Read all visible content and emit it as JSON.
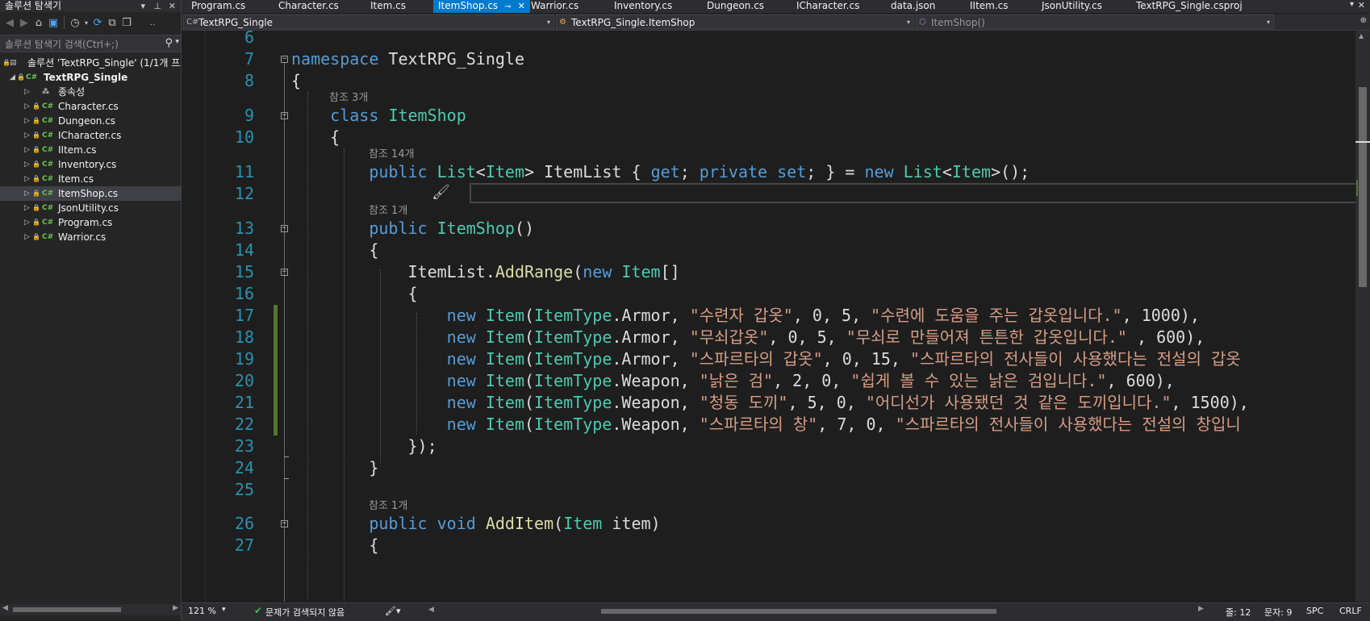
{
  "solution_explorer": {
    "title": "솔루션 탐색기",
    "search_placeholder": "솔루션 탐색기 검색(Ctrl+;)",
    "solution_label": "솔루션 'TextRPG_Single' (1/1개 프로",
    "project_label": "TextRPG_Single",
    "items": [
      {
        "label": "종속성"
      },
      {
        "label": "Character.cs"
      },
      {
        "label": "Dungeon.cs"
      },
      {
        "label": "ICharacter.cs"
      },
      {
        "label": "IItem.cs"
      },
      {
        "label": "Inventory.cs"
      },
      {
        "label": "Item.cs"
      },
      {
        "label": "ItemShop.cs"
      },
      {
        "label": "JsonUtility.cs"
      },
      {
        "label": "Program.cs"
      },
      {
        "label": "Warrior.cs"
      }
    ],
    "selected_item": "ItemShop.cs"
  },
  "tabs": [
    {
      "label": "Program.cs"
    },
    {
      "label": "Character.cs"
    },
    {
      "label": "Item.cs"
    },
    {
      "label": "ItemShop.cs",
      "active": true
    },
    {
      "label": "Warrior.cs"
    },
    {
      "label": "Inventory.cs"
    },
    {
      "label": "Dungeon.cs"
    },
    {
      "label": "ICharacter.cs"
    },
    {
      "label": "data.json"
    },
    {
      "label": "IItem.cs"
    },
    {
      "label": "JsonUtility.cs"
    },
    {
      "label": "TextRPG_Single.csproj"
    }
  ],
  "navbar": {
    "project": "TextRPG_Single",
    "type": "TextRPG_Single.ItemShop",
    "member": "ItemShop()"
  },
  "editor": {
    "lines": [
      {
        "n": "6",
        "tokens": []
      },
      {
        "n": "7",
        "tokens": [
          [
            "kw",
            "namespace"
          ],
          [
            "pl",
            " TextRPG_Single"
          ]
        ]
      },
      {
        "n": "8",
        "tokens": [
          [
            "pl",
            "{"
          ]
        ]
      },
      {
        "n": "9",
        "ref": "참조 3개",
        "tokens": [
          [
            "pl",
            "    "
          ],
          [
            "kw",
            "class"
          ],
          [
            "pl",
            " "
          ],
          [
            "ty",
            "ItemShop"
          ]
        ]
      },
      {
        "n": "10",
        "tokens": [
          [
            "pl",
            "    {"
          ]
        ]
      },
      {
        "n": "11",
        "ref": "참조 14개",
        "tokens": [
          [
            "pl",
            "        "
          ],
          [
            "kw",
            "public"
          ],
          [
            "pl",
            " "
          ],
          [
            "ty",
            "List"
          ],
          [
            "pl",
            "<"
          ],
          [
            "ty",
            "Item"
          ],
          [
            "pl",
            "> ItemList { "
          ],
          [
            "kw",
            "get"
          ],
          [
            "pl",
            "; "
          ],
          [
            "kw",
            "private"
          ],
          [
            "pl",
            " "
          ],
          [
            "kw",
            "set"
          ],
          [
            "pl",
            "; } = "
          ],
          [
            "kw",
            "new"
          ],
          [
            "pl",
            " "
          ],
          [
            "ty",
            "List"
          ],
          [
            "pl",
            "<"
          ],
          [
            "ty",
            "Item"
          ],
          [
            "pl",
            ">();"
          ]
        ]
      },
      {
        "n": "12",
        "tokens": []
      },
      {
        "n": "13",
        "ref": "참조 1개",
        "tokens": [
          [
            "pl",
            "        "
          ],
          [
            "kw",
            "public"
          ],
          [
            "pl",
            " "
          ],
          [
            "ty",
            "ItemShop"
          ],
          [
            "pl",
            "()"
          ]
        ]
      },
      {
        "n": "14",
        "tokens": [
          [
            "pl",
            "        {"
          ]
        ]
      },
      {
        "n": "15",
        "tokens": [
          [
            "pl",
            "            ItemList."
          ],
          [
            "fn",
            "AddRange"
          ],
          [
            "pl",
            "("
          ],
          [
            "kw",
            "new"
          ],
          [
            "pl",
            " "
          ],
          [
            "ty",
            "Item"
          ],
          [
            "pl",
            "[]"
          ]
        ]
      },
      {
        "n": "16",
        "tokens": [
          [
            "pl",
            "            {"
          ]
        ]
      },
      {
        "n": "17",
        "tokens": [
          [
            "pl",
            "                "
          ],
          [
            "kw",
            "new"
          ],
          [
            "pl",
            " "
          ],
          [
            "ty",
            "Item"
          ],
          [
            "pl",
            "("
          ],
          [
            "ty",
            "ItemType"
          ],
          [
            "pl",
            ".Armor, "
          ],
          [
            "st",
            "\"수련자 갑옷\""
          ],
          [
            "pl",
            ", 0, 5, "
          ],
          [
            "st",
            "\"수련에 도움을 주는 갑옷입니다.\""
          ],
          [
            "pl",
            ", 1000),"
          ]
        ]
      },
      {
        "n": "18",
        "tokens": [
          [
            "pl",
            "                "
          ],
          [
            "kw",
            "new"
          ],
          [
            "pl",
            " "
          ],
          [
            "ty",
            "Item"
          ],
          [
            "pl",
            "("
          ],
          [
            "ty",
            "ItemType"
          ],
          [
            "pl",
            ".Armor, "
          ],
          [
            "st",
            "\"무쇠갑옷\""
          ],
          [
            "pl",
            ", 0, 5, "
          ],
          [
            "st",
            "\"무쇠로 만들어져 튼튼한 갑옷입니다.\""
          ],
          [
            "pl",
            " , 600),"
          ]
        ]
      },
      {
        "n": "19",
        "tokens": [
          [
            "pl",
            "                "
          ],
          [
            "kw",
            "new"
          ],
          [
            "pl",
            " "
          ],
          [
            "ty",
            "Item"
          ],
          [
            "pl",
            "("
          ],
          [
            "ty",
            "ItemType"
          ],
          [
            "pl",
            ".Armor, "
          ],
          [
            "st",
            "\"스파르타의 갑옷\""
          ],
          [
            "pl",
            ", 0, 15, "
          ],
          [
            "st",
            "\"스파르타의 전사들이 사용했다는 전설의 갑옷"
          ]
        ]
      },
      {
        "n": "20",
        "tokens": [
          [
            "pl",
            "                "
          ],
          [
            "kw",
            "new"
          ],
          [
            "pl",
            " "
          ],
          [
            "ty",
            "Item"
          ],
          [
            "pl",
            "("
          ],
          [
            "ty",
            "ItemType"
          ],
          [
            "pl",
            ".Weapon, "
          ],
          [
            "st",
            "\"낡은 검\""
          ],
          [
            "pl",
            ", 2, 0, "
          ],
          [
            "st",
            "\"쉽게 볼 수 있는 낡은 검입니다.\""
          ],
          [
            "pl",
            ", 600),"
          ]
        ]
      },
      {
        "n": "21",
        "tokens": [
          [
            "pl",
            "                "
          ],
          [
            "kw",
            "new"
          ],
          [
            "pl",
            " "
          ],
          [
            "ty",
            "Item"
          ],
          [
            "pl",
            "("
          ],
          [
            "ty",
            "ItemType"
          ],
          [
            "pl",
            ".Weapon, "
          ],
          [
            "st",
            "\"청동 도끼\""
          ],
          [
            "pl",
            ", 5, 0, "
          ],
          [
            "st",
            "\"어디선가 사용됐던 것 같은 도끼입니다.\""
          ],
          [
            "pl",
            ", 1500),"
          ]
        ]
      },
      {
        "n": "22",
        "tokens": [
          [
            "pl",
            "                "
          ],
          [
            "kw",
            "new"
          ],
          [
            "pl",
            " "
          ],
          [
            "ty",
            "Item"
          ],
          [
            "pl",
            "("
          ],
          [
            "ty",
            "ItemType"
          ],
          [
            "pl",
            ".Weapon, "
          ],
          [
            "st",
            "\"스파르타의 창\""
          ],
          [
            "pl",
            ", 7, 0, "
          ],
          [
            "st",
            "\"스파르타의 전사들이 사용했다는 전설의 창입니"
          ]
        ]
      },
      {
        "n": "23",
        "tokens": [
          [
            "pl",
            "            });"
          ]
        ]
      },
      {
        "n": "24",
        "tokens": [
          [
            "pl",
            "        }"
          ]
        ]
      },
      {
        "n": "25",
        "tokens": []
      },
      {
        "n": "26",
        "ref": "참조 1개",
        "tokens": [
          [
            "pl",
            "        "
          ],
          [
            "kw",
            "public"
          ],
          [
            "pl",
            " "
          ],
          [
            "kw",
            "void"
          ],
          [
            "pl",
            " "
          ],
          [
            "fn",
            "AddItem"
          ],
          [
            "pl",
            "("
          ],
          [
            "ty",
            "Item"
          ],
          [
            "pl",
            " item)"
          ]
        ]
      },
      {
        "n": "27",
        "tokens": [
          [
            "pl",
            "        {"
          ]
        ]
      }
    ]
  },
  "status": {
    "zoom": "121 %",
    "issues": "문제가 검색되지 않음",
    "line": "줄: 12",
    "col": "문자: 9",
    "spc": "SPC",
    "eol": "CRLF"
  },
  "colors": {
    "accent": "#007acc",
    "keyword": "#569cd6",
    "type": "#4ec9b0",
    "string": "#d69d85",
    "method": "#dcdcaa",
    "line_number": "#2b91af",
    "change_marker": "#577430"
  }
}
